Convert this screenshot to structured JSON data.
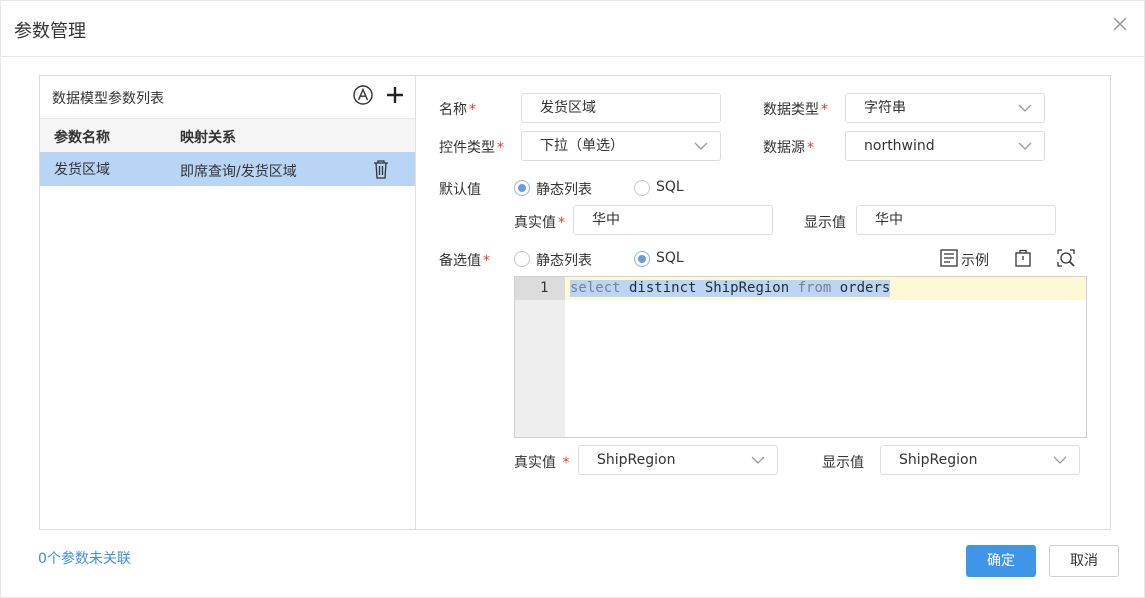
{
  "dialog": {
    "title": "参数管理"
  },
  "left": {
    "title": "数据模型参数列表",
    "headers": [
      "参数名称",
      "映射关系"
    ],
    "rows": [
      {
        "name": "发货区域",
        "mapping": "即席查询/发货区域"
      }
    ]
  },
  "form": {
    "name_label": "名称",
    "name_value": "发货区域",
    "datatype_label": "数据类型",
    "datatype_value": "字符串",
    "control_label": "控件类型",
    "control_value": "下拉（单选）",
    "datasource_label": "数据源",
    "datasource_value": "northwind",
    "default_label": "默认值",
    "radio_static": "静态列表",
    "radio_sql": "SQL",
    "default_mode": "静态列表",
    "real_label": "真实值",
    "real_value": "华中",
    "display_label": "显示值",
    "display_value": "华中",
    "alt_label": "备选值",
    "alt_mode": "SQL",
    "example_label": "示例",
    "editor": {
      "line_number": "1",
      "kw1": "select",
      "mid": " distinct ShipRegion ",
      "kw2": "from",
      "tail": " orders"
    },
    "alt_real_label": "真实值",
    "alt_real_value": "ShipRegion",
    "alt_display_label": "显示值",
    "alt_display_value": "ShipRegion",
    "required_mark": "*"
  },
  "footer": {
    "unlinked": "0个参数未关联",
    "ok": "确定",
    "cancel": "取消"
  },
  "icons": {
    "close": "close-icon",
    "a_circle": "circle-a-icon",
    "add": "plus-icon",
    "delete": "trash-icon",
    "example": "document-lines-icon",
    "clipboard": "clipboard-icon",
    "preview": "search-preview-icon",
    "dropdown": "chevron-down-icon"
  },
  "colors": {
    "primary": "#4096e6",
    "selected_row": "#b8d5f5",
    "required": "#e53935",
    "link": "#3d8fd9"
  }
}
